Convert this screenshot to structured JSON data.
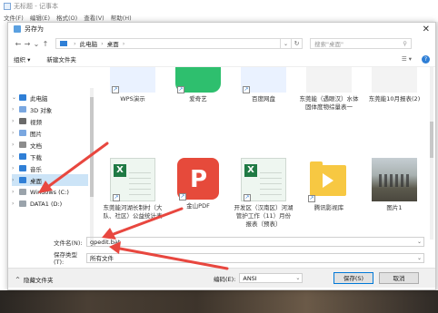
{
  "notepad": {
    "title": "无标题 - 记事本",
    "menu": [
      "文件(F)",
      "编辑(E)",
      "格式(O)",
      "查看(V)",
      "帮助(H)"
    ]
  },
  "dialog": {
    "title": "另存为",
    "close_icon": "close-icon",
    "breadcrumb": [
      "此电脑",
      "桌面"
    ],
    "search_placeholder": "搜索\"桌面\"",
    "toolbar": {
      "organize": "组织 ▾",
      "new_folder": "新建文件夹"
    },
    "sidebar": [
      {
        "label": "此电脑",
        "icon": "pc-icon",
        "color": "#2f7fd6"
      },
      {
        "label": "3D 对象",
        "icon": "3d-objects-icon",
        "color": "#7aa7e0"
      },
      {
        "label": "视频",
        "icon": "videos-icon",
        "color": "#6a6a6a"
      },
      {
        "label": "图片",
        "icon": "pictures-icon",
        "color": "#7aa7e0"
      },
      {
        "label": "文档",
        "icon": "documents-icon",
        "color": "#8c8c8c"
      },
      {
        "label": "下载",
        "icon": "downloads-icon",
        "color": "#2f7fd6"
      },
      {
        "label": "音乐",
        "icon": "music-icon",
        "color": "#2f7fd6"
      },
      {
        "label": "桌面",
        "icon": "desktop-icon",
        "color": "#2f7fd6",
        "selected": true
      },
      {
        "label": "Windows (C:)",
        "icon": "drive-icon",
        "color": "#9aa3ab"
      },
      {
        "label": "DATA1 (D:)",
        "icon": "drive-icon",
        "color": "#9aa3ab"
      }
    ],
    "files_row1": [
      {
        "label": "WPS演示",
        "icon": "wps-icon"
      },
      {
        "label": "爱奇艺",
        "icon": "iqiyi-icon"
      },
      {
        "label": "百度网盘",
        "icon": "baidu-netdisk-icon"
      },
      {
        "label": "东莞能（遇眼汉）水体固体度物综量表一",
        "icon": "excel-file-icon"
      },
      {
        "label": "东莞能10月报表(2)",
        "icon": "excel-file-icon"
      }
    ],
    "files_row2": [
      {
        "label": "东莞能河湖长制村（大队、社区）公益统计表",
        "icon": "excel-file-icon"
      },
      {
        "label": "金山PDF",
        "icon": "pdf-icon"
      },
      {
        "label": "开发区（汉南区）河湖管护工作（11）月份报表（预表）",
        "icon": "excel-file-icon"
      },
      {
        "label": "腾讯影视库",
        "icon": "video-folder-icon"
      },
      {
        "label": "图片1",
        "icon": "image-file-icon"
      }
    ],
    "filename_label": "文件名(N):",
    "filename_value": "gpedit.bat",
    "filetype_label": "保存类型(T):",
    "filetype_value": "所有文件",
    "hide_folders": "隐藏文件夹",
    "encoding_label": "编码(E):",
    "encoding_value": "ANSI",
    "save_button": "保存(S)",
    "cancel_button": "取消"
  },
  "colors": {
    "annotation_arrow": "#e8473f",
    "accent": "#2f7fd6",
    "excel": "#1f7a44"
  }
}
